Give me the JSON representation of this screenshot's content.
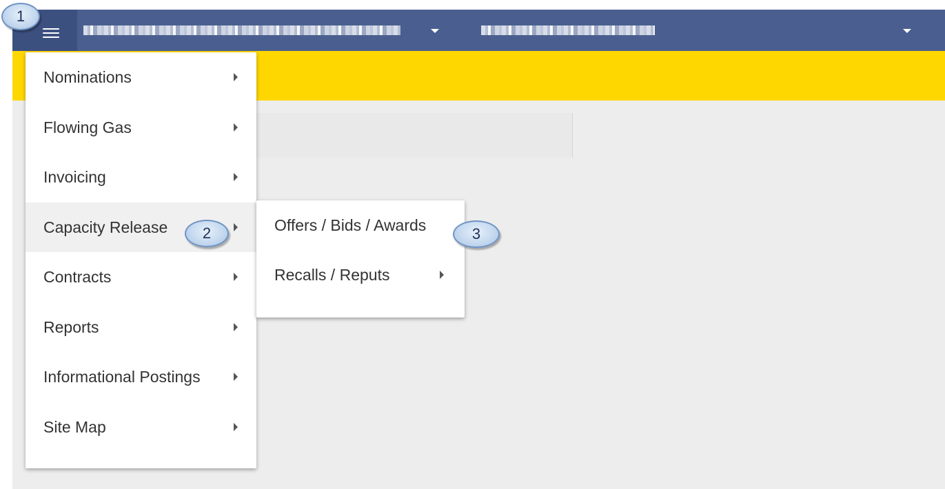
{
  "menu": {
    "items": [
      {
        "label": "Nominations"
      },
      {
        "label": "Flowing Gas"
      },
      {
        "label": "Invoicing"
      },
      {
        "label": "Capacity Release"
      },
      {
        "label": "Contracts"
      },
      {
        "label": "Reports"
      },
      {
        "label": "Informational Postings"
      },
      {
        "label": "Site Map"
      }
    ]
  },
  "submenu": {
    "items": [
      {
        "label": "Offers / Bids / Awards"
      },
      {
        "label": "Recalls / Reputs"
      }
    ]
  },
  "callouts": [
    "1",
    "2",
    "3"
  ],
  "colors": {
    "topbar": "#4a5f8f",
    "banner": "#ffd700",
    "background": "#ededed",
    "callout_border": "#6f93c4"
  },
  "icons": {
    "menu_toggle": "hamburger-icon",
    "dropdown": "caret-down-icon",
    "submenu": "caret-right-icon"
  }
}
